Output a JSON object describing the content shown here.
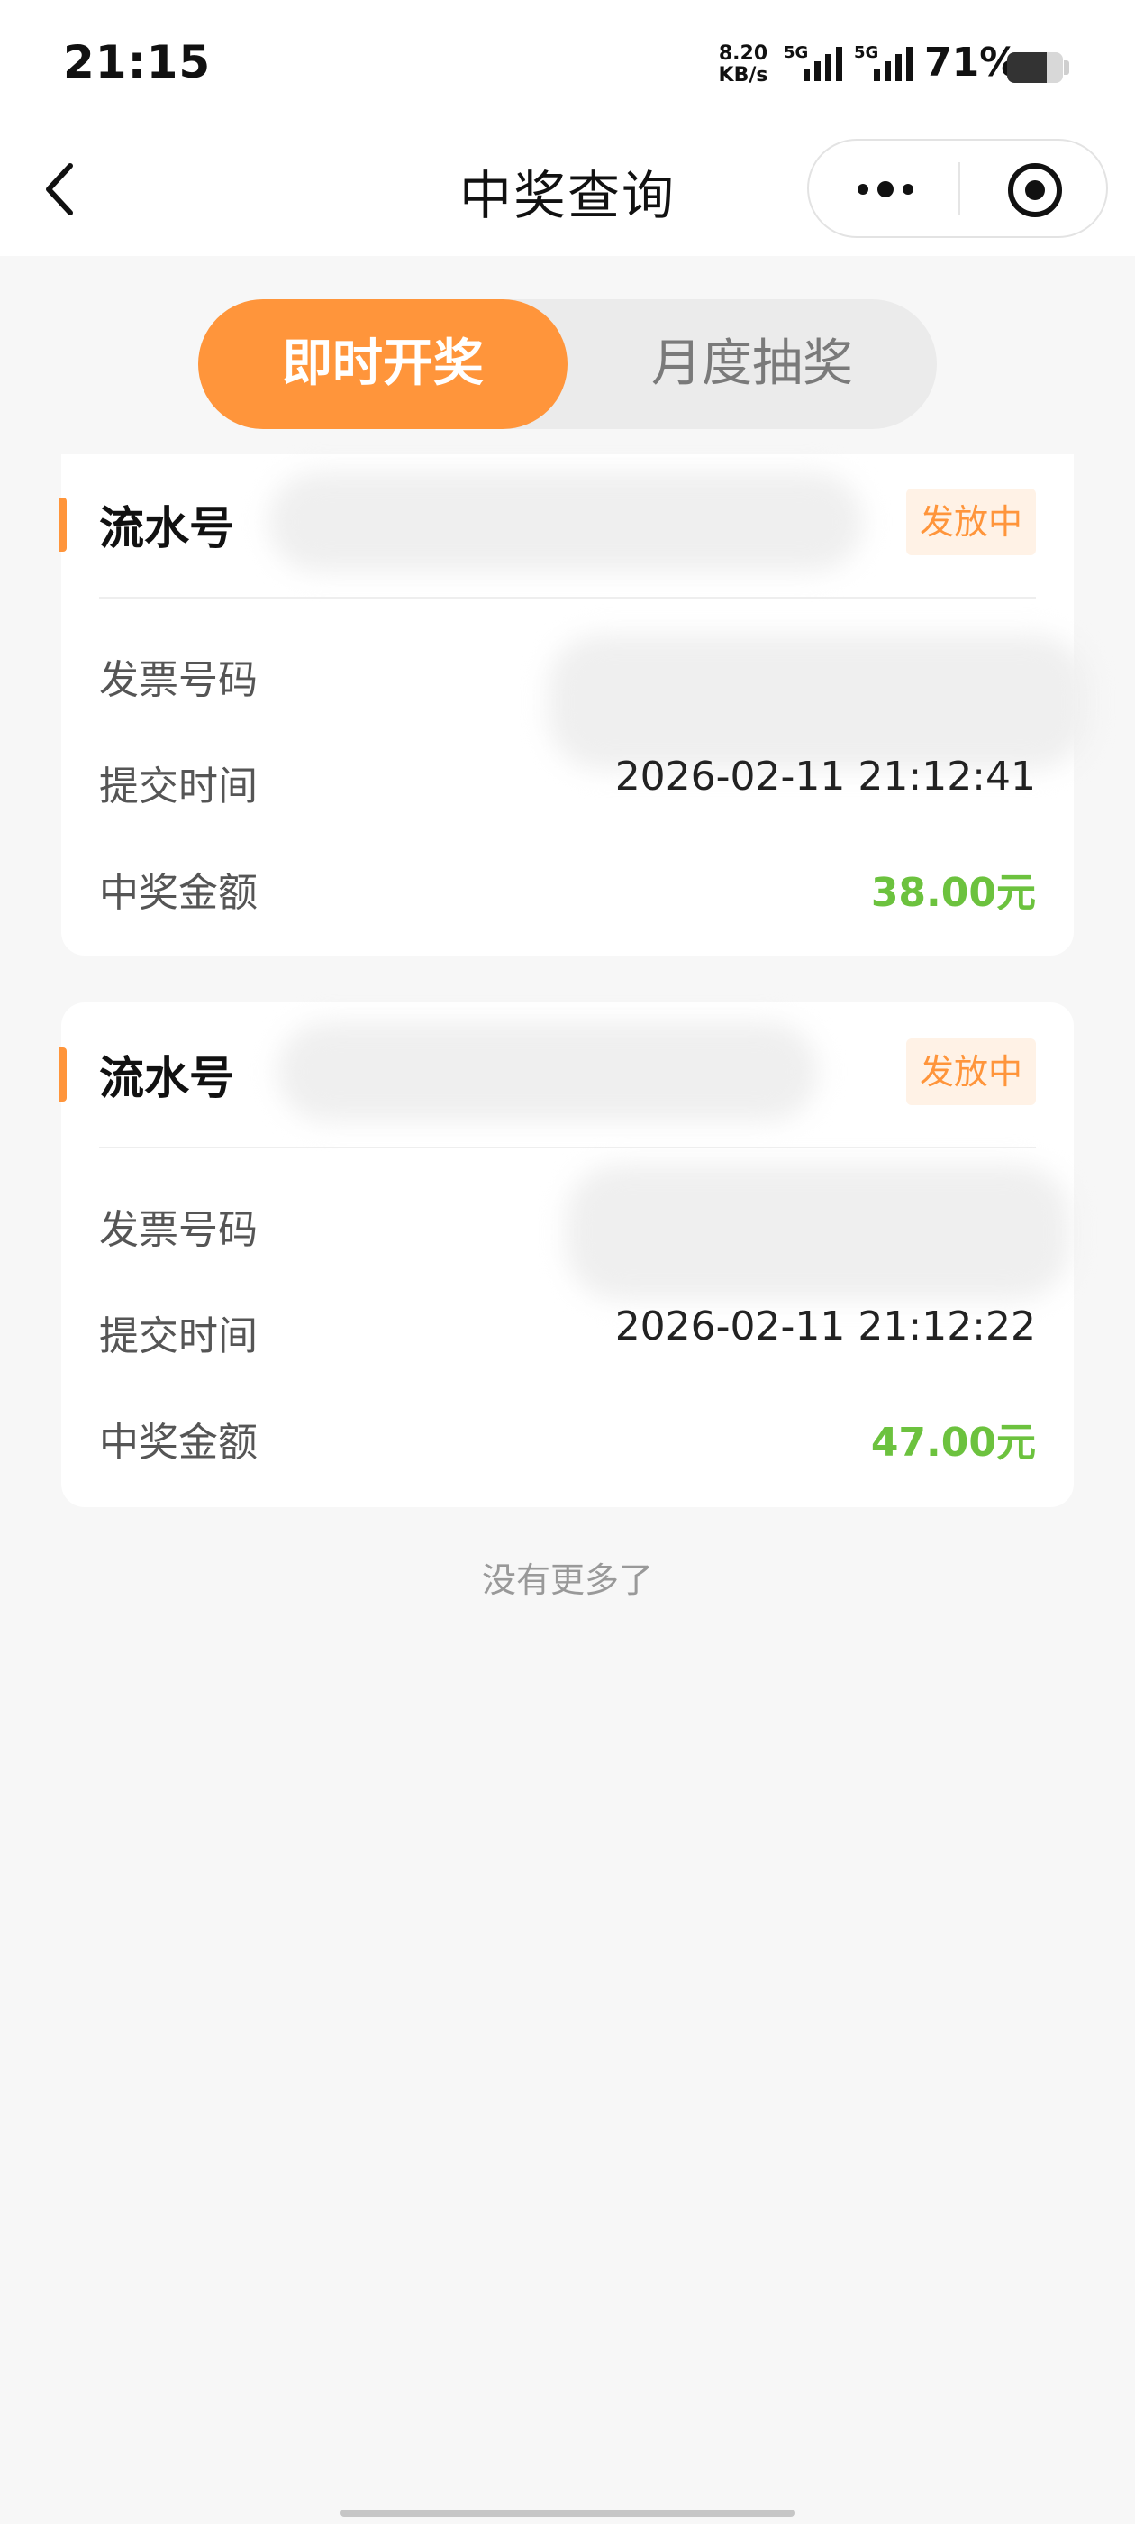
{
  "status_bar": {
    "time": "21:15",
    "net_speed_value": "8.20",
    "net_speed_unit": "KB/s",
    "signal1_label": "5G",
    "signal2_label": "5G",
    "battery_percent": "71%",
    "battery_level": 0.71
  },
  "nav": {
    "title": "中奖查询",
    "more_icon": "more-dots-icon",
    "close_icon": "target-circle-icon",
    "back_icon": "chevron-left-icon"
  },
  "tabs": {
    "instant": "即时开奖",
    "monthly": "月度抽奖",
    "active": "instant"
  },
  "labels": {
    "serial": "流水号",
    "invoice": "发票号码",
    "submit_time": "提交时间",
    "amount": "中奖金额"
  },
  "records": [
    {
      "status": "发放中",
      "submit_time": "2026-02-11 21:12:41",
      "amount": "38.00元"
    },
    {
      "status": "发放中",
      "submit_time": "2026-02-11 21:12:22",
      "amount": "47.00元"
    }
  ],
  "footer": {
    "end_text": "没有更多了"
  },
  "colors": {
    "accent": "#ff953b",
    "amount": "#6cc23e",
    "background": "#f7f7f7"
  }
}
